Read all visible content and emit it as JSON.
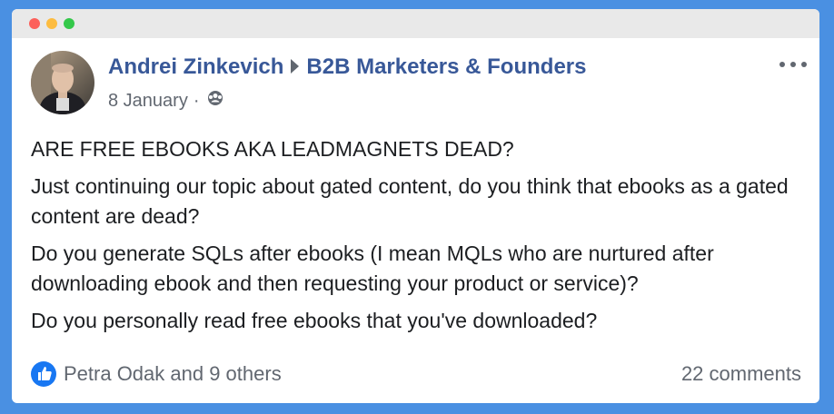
{
  "post": {
    "author": "Andrei Zinkevich",
    "group": "B2B Marketers & Founders",
    "date": "8 January",
    "visibility_icon": "members-icon",
    "paragraphs": [
      "ARE FREE EBOOKS AKA LEADMAGNETS DEAD?",
      "Just continuing our topic about gated content, do you think that ebooks as a gated content are dead?",
      "Do you generate SQLs after ebooks (I mean MQLs who are nurtured after downloading ebook and then requesting your product or service)?",
      "Do you personally read free ebooks that you've downloaded?"
    ],
    "reactions_text": "Petra Odak and 9 others",
    "comments_text": "22 comments"
  },
  "colors": {
    "link": "#385898",
    "text": "#1c1e21",
    "muted": "#616770",
    "like": "#1877f2",
    "background": "#4a90e2"
  }
}
